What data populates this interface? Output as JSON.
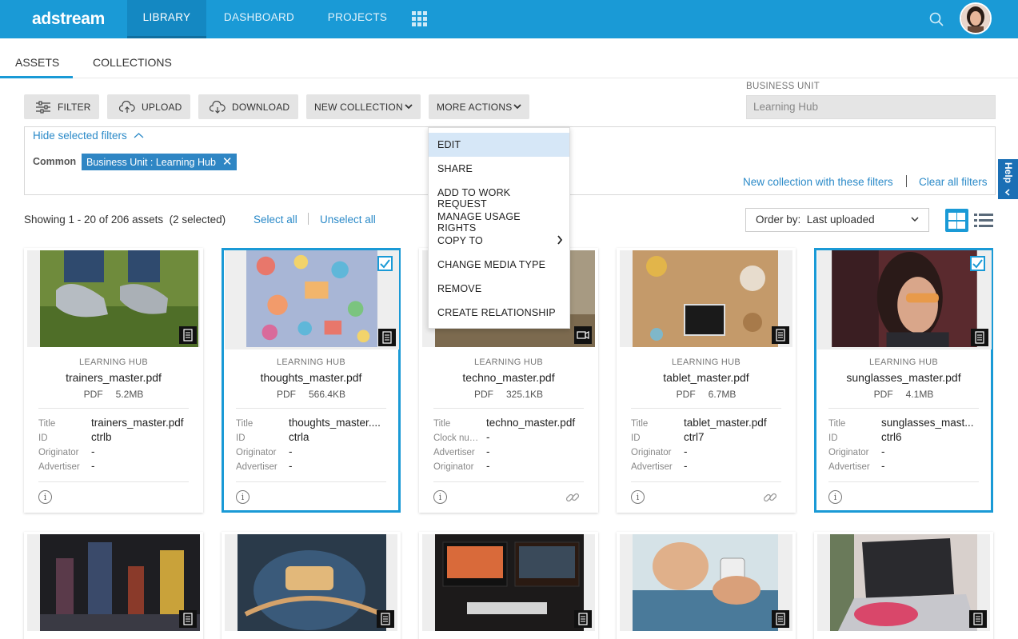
{
  "nav": {
    "logo": "adstream",
    "tabs": [
      {
        "label": "LIBRARY",
        "active": true
      },
      {
        "label": "DASHBOARD",
        "active": false
      },
      {
        "label": "PROJECTS",
        "active": false
      }
    ]
  },
  "subtabs": [
    {
      "label": "ASSETS",
      "active": true
    },
    {
      "label": "COLLECTIONS",
      "active": false
    }
  ],
  "toolbar": {
    "filter": "FILTER",
    "upload": "UPLOAD",
    "download": "DOWNLOAD",
    "new_collection": "NEW COLLECTION",
    "more_actions": "MORE ACTIONS"
  },
  "business_unit": {
    "label": "BUSINESS UNIT",
    "value": "Learning Hub"
  },
  "filters": {
    "hide_label": "Hide selected filters",
    "common_label": "Common",
    "chip": "Business Unit : Learning Hub",
    "new_collection_link": "New collection with these filters",
    "clear_all": "Clear all filters"
  },
  "help": "Help",
  "results": {
    "showing": "Showing 1 - 20 of 206 assets  (2 selected)",
    "select_all": "Select all",
    "unselect_all": "Unselect all",
    "order_by": "Order by:  Last uploaded"
  },
  "menu": {
    "items": [
      "EDIT",
      "SHARE",
      "ADD TO WORK REQUEST",
      "MANAGE USAGE RIGHTS",
      "COPY TO",
      "CHANGE MEDIA TYPE",
      "REMOVE",
      "CREATE RELATIONSHIP"
    ]
  },
  "cards": [
    {
      "bu": "LEARNING HUB",
      "name": "trainers_master.pdf",
      "type": "PDF",
      "size": "5.2MB",
      "meta": [
        [
          "Title",
          "trainers_master.pdf"
        ],
        [
          "ID",
          "ctrlb"
        ],
        [
          "Originator",
          "-"
        ],
        [
          "Advertiser",
          "-"
        ]
      ]
    },
    {
      "bu": "LEARNING HUB",
      "name": "thoughts_master.pdf",
      "type": "PDF",
      "size": "566.4KB",
      "meta": [
        [
          "Title",
          "thoughts_master...."
        ],
        [
          "ID",
          "ctrla"
        ],
        [
          "Originator",
          "-"
        ],
        [
          "Advertiser",
          "-"
        ]
      ]
    },
    {
      "bu": "LEARNING HUB",
      "name": "techno_master.pdf",
      "type": "PDF",
      "size": "325.1KB",
      "meta": [
        [
          "Title",
          "techno_master.pdf"
        ],
        [
          "Clock num...",
          "-"
        ],
        [
          "Advertiser",
          "-"
        ],
        [
          "Originator",
          "-"
        ]
      ]
    },
    {
      "bu": "LEARNING HUB",
      "name": "tablet_master.pdf",
      "type": "PDF",
      "size": "6.7MB",
      "meta": [
        [
          "Title",
          "tablet_master.pdf"
        ],
        [
          "ID",
          "ctrl7"
        ],
        [
          "Originator",
          "-"
        ],
        [
          "Advertiser",
          "-"
        ]
      ]
    },
    {
      "bu": "LEARNING HUB",
      "name": "sunglasses_master.pdf",
      "type": "PDF",
      "size": "4.1MB",
      "meta": [
        [
          "Title",
          "sunglasses_mast..."
        ],
        [
          "ID",
          "ctrl6"
        ],
        [
          "Originator",
          "-"
        ],
        [
          "Advertiser",
          "-"
        ]
      ]
    }
  ]
}
